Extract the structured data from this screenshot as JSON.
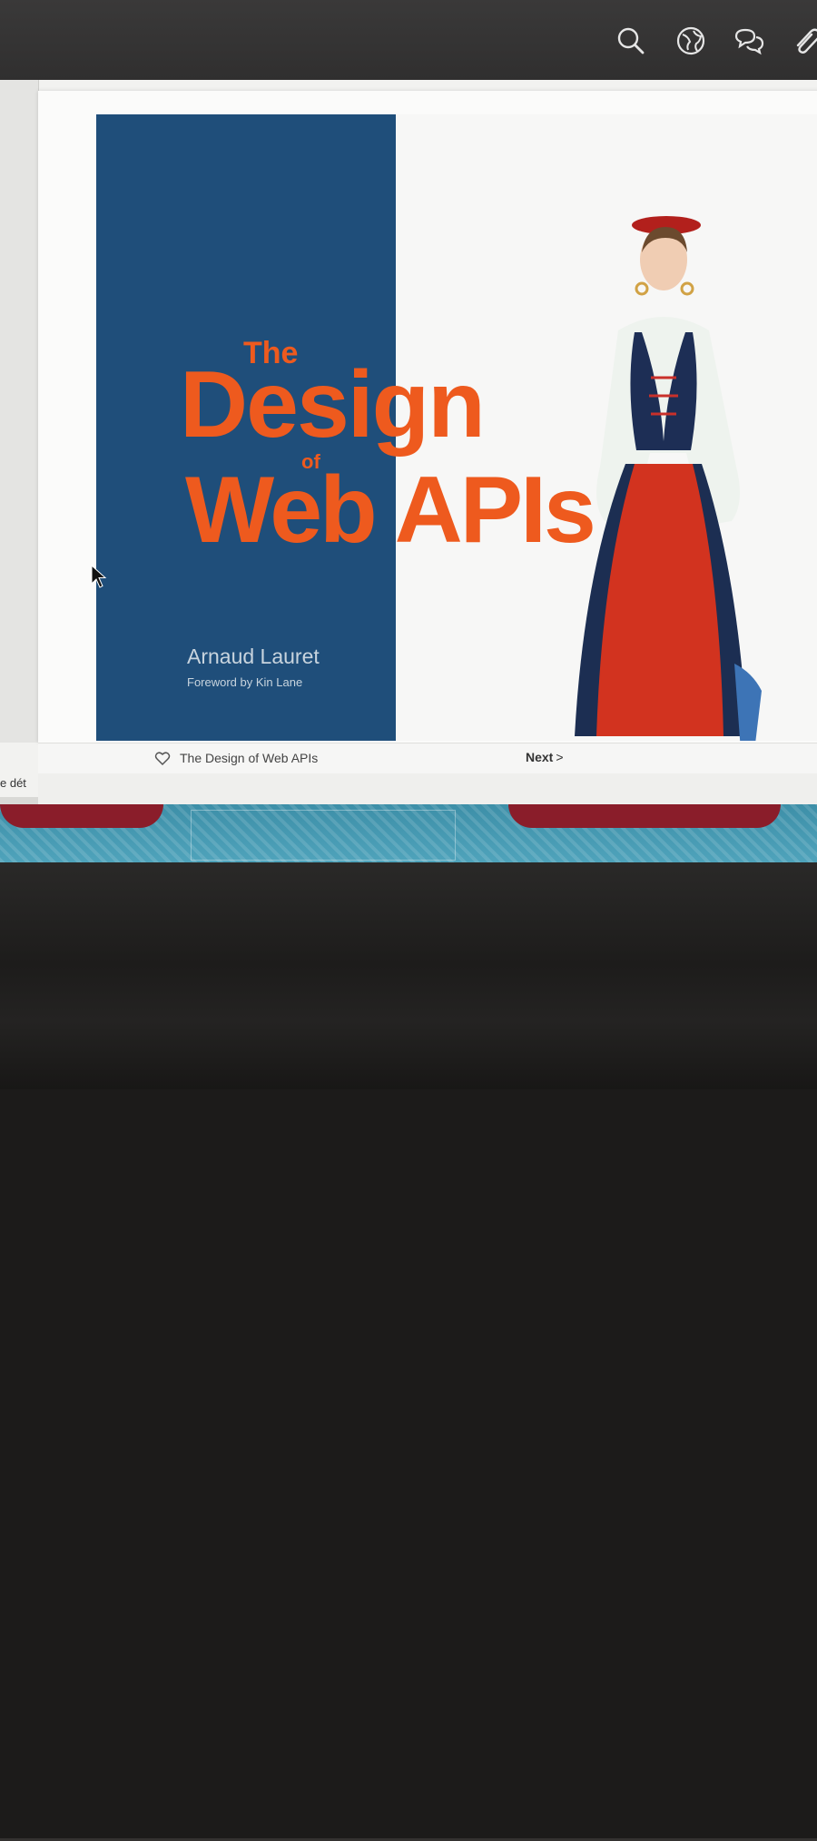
{
  "toolbar": {
    "icons": [
      "search-icon",
      "globe-icon",
      "chat-icon",
      "paperclip-icon"
    ]
  },
  "book_cover": {
    "title_the": "The",
    "title_design": "Design",
    "title_of": "of",
    "title_web_apis": "Web APIs",
    "author": "Arnaud Lauret",
    "foreword": "Foreword by Kin Lane",
    "colors": {
      "band": "#1f4e7a",
      "title": "#ee5a1e"
    }
  },
  "footer": {
    "book_link": "The Design of Web APIs",
    "next_label": "Next",
    "next_chevron": ">"
  },
  "side_text": "e dét"
}
